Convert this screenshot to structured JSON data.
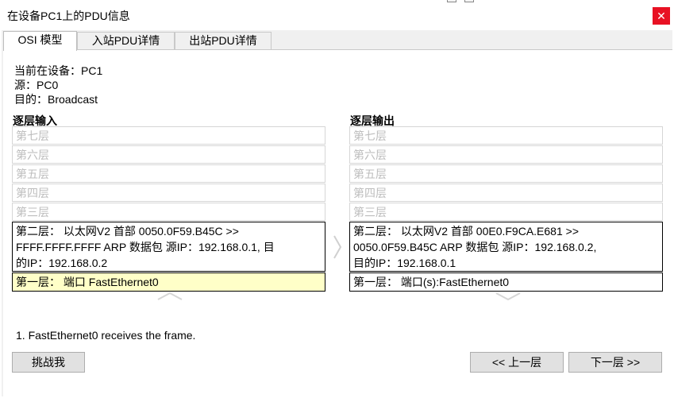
{
  "window": {
    "title": "在设备PC1上的PDU信息"
  },
  "tabs": [
    "OSI 模型",
    "入站PDU详情",
    "出站PDU详情"
  ],
  "info": {
    "device_line": "当前在设备：PC1",
    "source_line": "源：PC0",
    "dest_line": "目的：Broadcast"
  },
  "in_layers": {
    "heading": "逐层输入",
    "layer7": "第七层",
    "layer6": "第六层",
    "layer5": "第五层",
    "layer4": "第四层",
    "layer3": "第三层",
    "layer2": [
      "第二层： 以太网V2 首部 0050.0F59.B45C >>",
      "FFFF.FFFF.FFFF ARP 数据包 源IP：192.168.0.1, 目",
      "的IP：192.168.0.2"
    ],
    "layer1": "第一层： 端口 FastEthernet0"
  },
  "out_layers": {
    "heading": "逐层输出",
    "layer7": "第七层",
    "layer6": "第六层",
    "layer5": "第五层",
    "layer4": "第四层",
    "layer3": "第三层",
    "layer2": [
      "第二层： 以太网V2 首部 00E0.F9CA.E681 >>",
      "0050.0F59.B45C ARP 数据包 源IP：192.168.0.2,",
      "目的IP：192.168.0.1"
    ],
    "layer1": "第一层： 端口(s):FastEthernet0"
  },
  "step_text": "1. FastEthernet0 receives the frame.",
  "buttons": {
    "challenge": "挑战我",
    "prev": "<< 上一层",
    "next": "下一层 >>"
  },
  "colors": {
    "close_bg": "#e81123",
    "highlight": "#ffffc8",
    "panel_bg": "#ffffff",
    "dialog_bg": "#f0f0f0"
  }
}
